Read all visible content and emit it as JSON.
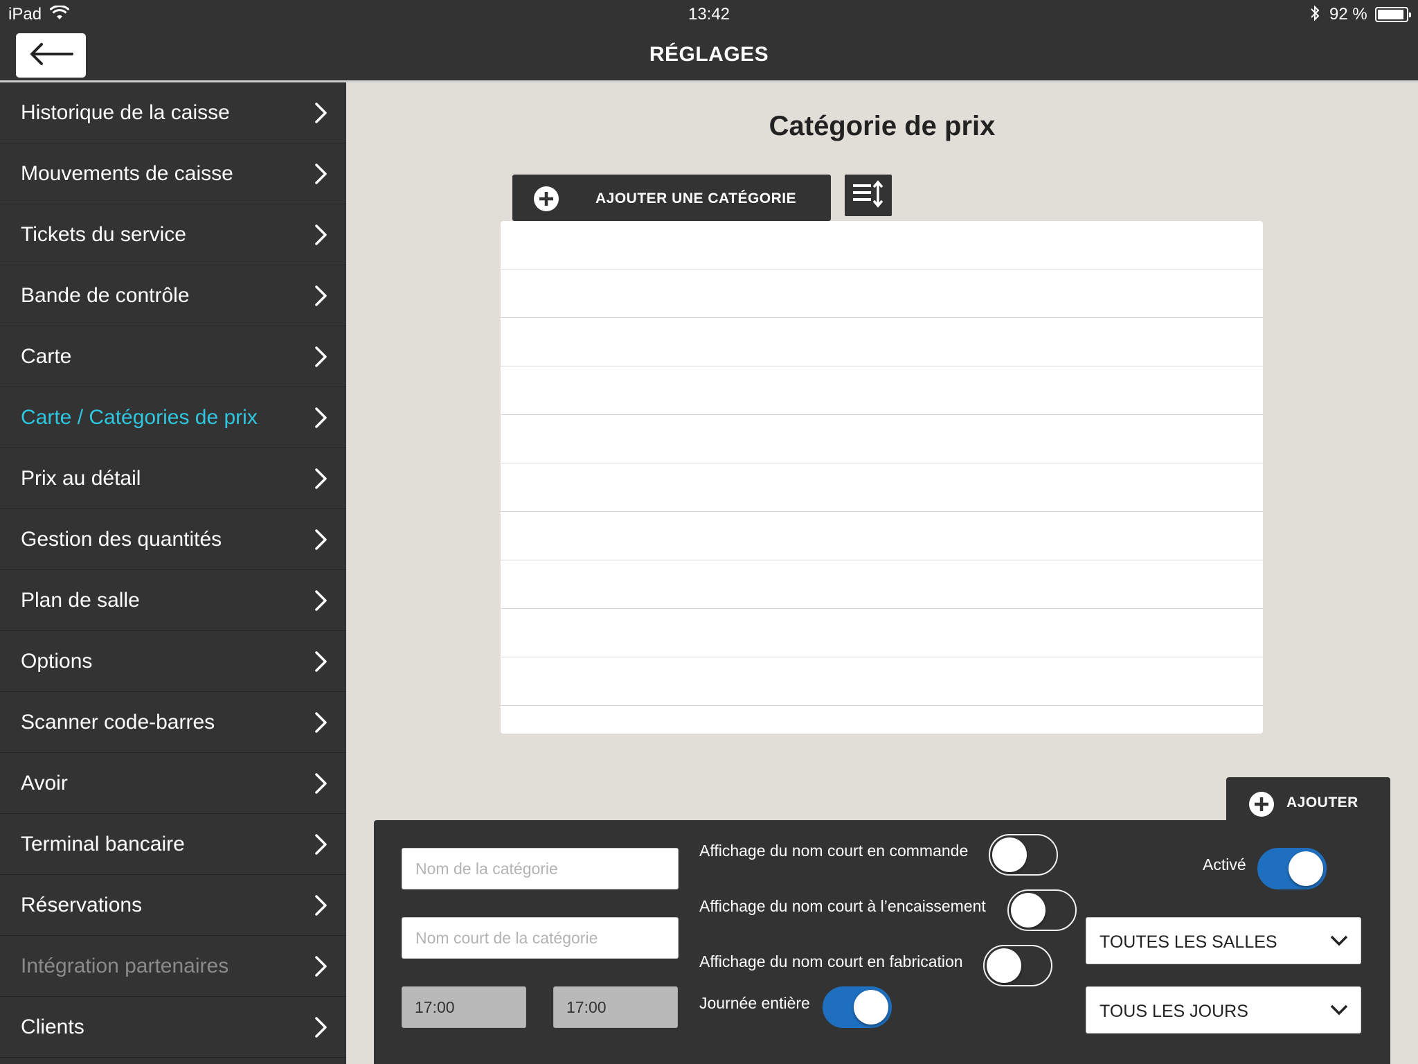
{
  "status_bar": {
    "device": "iPad",
    "time": "13:42",
    "battery_text": "92 %",
    "battery_level": 0.92,
    "icons": [
      "wifi-icon",
      "bluetooth-icon",
      "battery-icon"
    ]
  },
  "header": {
    "title": "RÉGLAGES",
    "back_icon": "arrow-left-icon"
  },
  "sidebar": {
    "items": [
      {
        "label": "Historique de la caisse",
        "state": "normal"
      },
      {
        "label": "Mouvements de caisse",
        "state": "normal"
      },
      {
        "label": "Tickets du service",
        "state": "normal"
      },
      {
        "label": "Bande de contrôle",
        "state": "normal"
      },
      {
        "label": "Carte",
        "state": "normal"
      },
      {
        "label": "Carte / Catégories de prix",
        "state": "active"
      },
      {
        "label": "Prix au détail",
        "state": "normal"
      },
      {
        "label": "Gestion des quantités",
        "state": "normal"
      },
      {
        "label": "Plan de salle",
        "state": "normal"
      },
      {
        "label": "Options",
        "state": "normal"
      },
      {
        "label": "Scanner code-barres",
        "state": "normal"
      },
      {
        "label": "Avoir",
        "state": "normal"
      },
      {
        "label": "Terminal bancaire",
        "state": "normal"
      },
      {
        "label": "Réservations",
        "state": "normal"
      },
      {
        "label": "Intégration partenaires",
        "state": "disabled"
      },
      {
        "label": "Clients",
        "state": "normal"
      }
    ]
  },
  "main": {
    "title": "Catégorie de prix",
    "add_category_label": "AJOUTER UNE CATÉGORIE",
    "sort_icon": "sort-icon",
    "list_rows": 10
  },
  "form": {
    "add_label": "AJOUTER",
    "name_placeholder": "Nom de la catégorie",
    "short_name_placeholder": "Nom court de la catégorie",
    "time_start": "17:00",
    "time_end": "17:00",
    "toggles": {
      "short_name_order": {
        "label": "Affichage du nom court en commande",
        "on": false
      },
      "short_name_checkout": {
        "label": "Affichage du nom court à l’encaissement",
        "on": false
      },
      "short_name_kitchen": {
        "label": "Affichage du nom court en fabrication",
        "on": false
      },
      "full_day": {
        "label": "Journée entière",
        "on": true
      },
      "active": {
        "label": "Activé",
        "on": true
      }
    },
    "rooms_select": "TOUTES LES SALLES",
    "days_select": "TOUS LES JOURS"
  },
  "colors": {
    "dark": "#333333",
    "content_bg": "#e1ddd7",
    "active_item": "#2fc6e0",
    "toggle_on": "#1f6fc0"
  }
}
